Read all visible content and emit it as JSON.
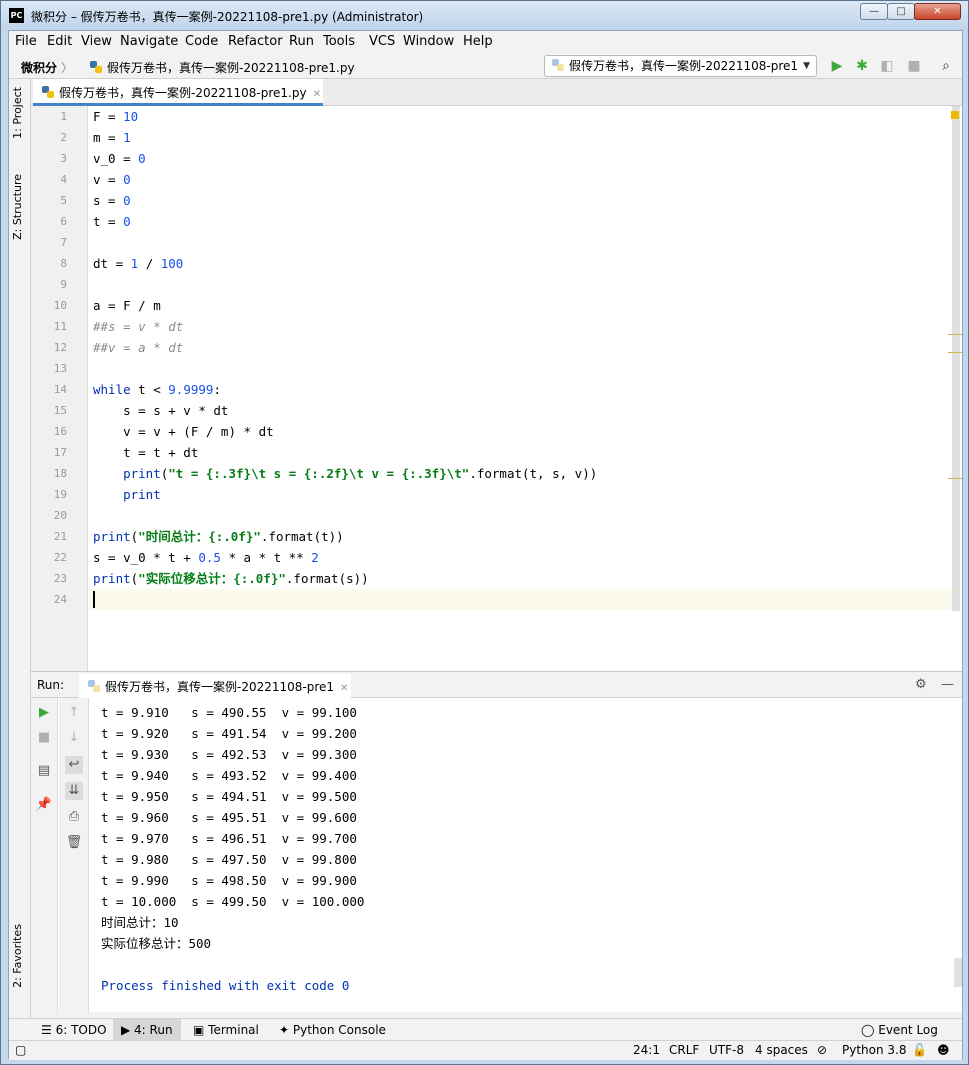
{
  "window": {
    "app_logo": "PC",
    "title": "微积分 – 假传万卷书，真传一案例-20221108-pre1.py (Administrator)",
    "controls": {
      "minimize": "—",
      "maximize": "□",
      "close": "✕"
    }
  },
  "menu": [
    "File",
    "Edit",
    "View",
    "Navigate",
    "Code",
    "Refactor",
    "Run",
    "Tools",
    "VCS",
    "Window",
    "Help"
  ],
  "navbar": {
    "project": "微积分",
    "separator": "〉",
    "file": "假传万卷书，真传一案例-20221108-pre1.py",
    "run_config": "假传万卷书，真传一案例-20221108-pre1",
    "icons": [
      "run-icon",
      "debug-icon",
      "coverage-icon",
      "stop-icon",
      "search-icon"
    ]
  },
  "side_tabs": {
    "project": "1: Project",
    "structure": "Z: Structure",
    "favorites": "2: Favorites"
  },
  "editor": {
    "tab_label": "假传万卷书，真传一案例-20221108-pre1.py",
    "line_numbers": [
      "1",
      "2",
      "3",
      "4",
      "5",
      "6",
      "7",
      "8",
      "9",
      "10",
      "11",
      "12",
      "13",
      "14",
      "15",
      "16",
      "17",
      "18",
      "19",
      "20",
      "21",
      "22",
      "23",
      "24"
    ],
    "lines": [
      [
        {
          "t": "F = ",
          "c": ""
        },
        {
          "t": "10",
          "c": "num"
        }
      ],
      [
        {
          "t": "m = ",
          "c": ""
        },
        {
          "t": "1",
          "c": "num"
        }
      ],
      [
        {
          "t": "v_0 = ",
          "c": ""
        },
        {
          "t": "0",
          "c": "num"
        }
      ],
      [
        {
          "t": "v = ",
          "c": ""
        },
        {
          "t": "0",
          "c": "num"
        }
      ],
      [
        {
          "t": "s = ",
          "c": ""
        },
        {
          "t": "0",
          "c": "num"
        }
      ],
      [
        {
          "t": "t = ",
          "c": ""
        },
        {
          "t": "0",
          "c": "num"
        }
      ],
      [],
      [
        {
          "t": "dt = ",
          "c": ""
        },
        {
          "t": "1",
          "c": "num"
        },
        {
          "t": " / ",
          "c": ""
        },
        {
          "t": "100",
          "c": "num"
        }
      ],
      [],
      [
        {
          "t": "a = F / m",
          "c": ""
        }
      ],
      [
        {
          "t": "##s = v * dt",
          "c": "cmt"
        }
      ],
      [
        {
          "t": "##v = a * dt",
          "c": "cmt"
        }
      ],
      [],
      [
        {
          "t": "while",
          "c": "kw"
        },
        {
          "t": " t < ",
          "c": ""
        },
        {
          "t": "9.9999",
          "c": "num"
        },
        {
          "t": ":",
          "c": ""
        }
      ],
      [
        {
          "t": "    s = s + v * dt",
          "c": ""
        }
      ],
      [
        {
          "t": "    v = v + (F / m) * dt",
          "c": ""
        }
      ],
      [
        {
          "t": "    t = t + dt",
          "c": ""
        }
      ],
      [
        {
          "t": "    ",
          "c": ""
        },
        {
          "t": "print",
          "c": "kw"
        },
        {
          "t": "(",
          "c": ""
        },
        {
          "t": "\"t = {:.3f}\\t s = {:.2f}\\t v = {:.3f}\\t\"",
          "c": "str"
        },
        {
          "t": ".format(t, s, v))",
          "c": ""
        }
      ],
      [
        {
          "t": "    ",
          "c": ""
        },
        {
          "t": "print",
          "c": "kw"
        }
      ],
      [],
      [
        {
          "t": "print",
          "c": "kw"
        },
        {
          "t": "(",
          "c": ""
        },
        {
          "t": "\"时间总计：{:.0f}\"",
          "c": "str"
        },
        {
          "t": ".format(t))",
          "c": ""
        }
      ],
      [
        {
          "t": "s = v_0 * t + ",
          "c": ""
        },
        {
          "t": "0.5",
          "c": "num"
        },
        {
          "t": " * a * t ** ",
          "c": ""
        },
        {
          "t": "2",
          "c": "num"
        }
      ],
      [
        {
          "t": "print",
          "c": "kw"
        },
        {
          "t": "(",
          "c": ""
        },
        {
          "t": "\"实际位移总计：{:.0f}\"",
          "c": "str"
        },
        {
          "t": ".format(s))",
          "c": ""
        }
      ],
      []
    ]
  },
  "run": {
    "label": "Run:",
    "tab_label": "假传万卷书，真传一案例-20221108-pre1",
    "output": [
      "t = 9.910   s = 490.55  v = 99.100",
      "t = 9.920   s = 491.54  v = 99.200",
      "t = 9.930   s = 492.53  v = 99.300",
      "t = 9.940   s = 493.52  v = 99.400",
      "t = 9.950   s = 494.51  v = 99.500",
      "t = 9.960   s = 495.51  v = 99.600",
      "t = 9.970   s = 496.51  v = 99.700",
      "t = 9.980   s = 497.50  v = 99.800",
      "t = 9.990   s = 498.50  v = 99.900",
      "t = 10.000  s = 499.50  v = 100.000",
      "时间总计：10",
      "实际位移总计：500",
      "",
      "Process finished with exit code 0"
    ]
  },
  "bottom_tabs": {
    "todo": "6: TODO",
    "run": "4: Run",
    "terminal": "Terminal",
    "python_console": "Python Console",
    "event_log": "Event Log"
  },
  "status": {
    "position": "24:1",
    "line_sep": "CRLF",
    "encoding": "UTF-8",
    "indent": "4 spaces",
    "interpreter": "Python 3.8"
  },
  "colors": {
    "accent": "#4083c9",
    "keyword": "#0033b3",
    "number": "#1750eb",
    "string": "#067d17",
    "comment": "#8c8c8c",
    "run_green": "#3ca93c"
  }
}
